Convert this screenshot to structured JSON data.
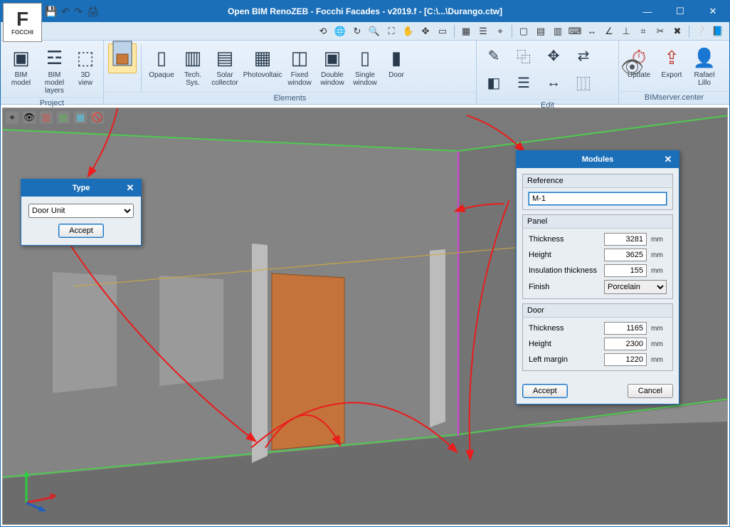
{
  "app": {
    "title": "Open BIM RenoZEB - Focchi Facades - v2019.f - [C:\\...\\Durango.ctw]",
    "brand": "FOCCHI"
  },
  "ribbon": {
    "groups": {
      "project": {
        "label": "Project",
        "bim_model": "BIM model",
        "bim_layers": "BIM model layers",
        "view3d": "3D view"
      },
      "elements": {
        "label": "Elements",
        "opaque": "Opaque",
        "tech": "Tech. Sys.",
        "solar": "Solar collector",
        "pv": "Photovoltaic",
        "fixed": "Fixed window",
        "double": "Double window",
        "single": "Single window",
        "door": "Door"
      },
      "edit": {
        "label": "Edit"
      },
      "server": {
        "label": "BIMserver.center",
        "update": "Update",
        "export": "Export",
        "user": "Rafael Lillo"
      }
    }
  },
  "type_dialog": {
    "title": "Type",
    "option": "Door Unit",
    "accept": "Accept"
  },
  "modules_dialog": {
    "title": "Modules",
    "reference": {
      "legend": "Reference",
      "value": "M-1"
    },
    "panel": {
      "legend": "Panel",
      "thickness": {
        "label": "Thickness",
        "value": "3281",
        "unit": "mm"
      },
      "height": {
        "label": "Height",
        "value": "3625",
        "unit": "mm"
      },
      "insulation": {
        "label": "Insulation thickness",
        "value": "155",
        "unit": "mm"
      },
      "finish": {
        "label": "Finish",
        "value": "Porcelain"
      }
    },
    "door": {
      "legend": "Door",
      "thickness": {
        "label": "Thickness",
        "value": "1165",
        "unit": "mm"
      },
      "height": {
        "label": "Height",
        "value": "2300",
        "unit": "mm"
      },
      "left_margin": {
        "label": "Left margin",
        "value": "1220",
        "unit": "mm"
      }
    },
    "accept": "Accept",
    "cancel": "Cancel"
  }
}
